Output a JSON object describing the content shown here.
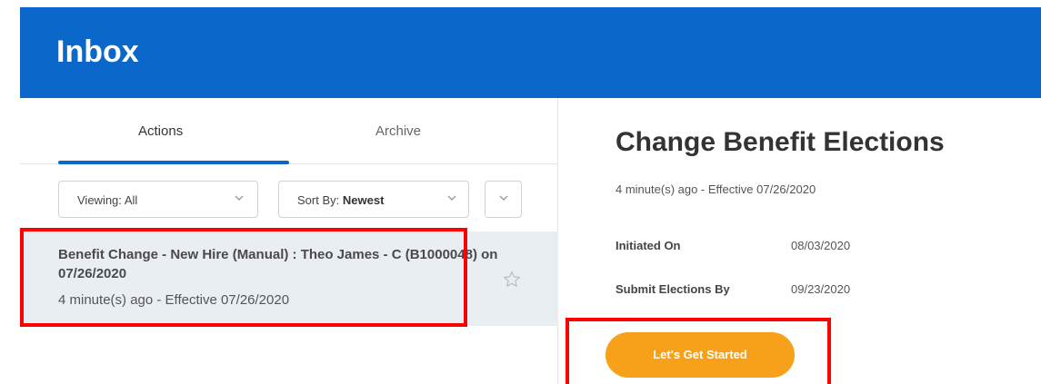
{
  "header": {
    "title": "Inbox"
  },
  "tabs": [
    {
      "label": "Actions",
      "active": true
    },
    {
      "label": "Archive",
      "active": false
    }
  ],
  "filters": {
    "viewing": {
      "label": "Viewing:",
      "value": "All"
    },
    "sort": {
      "label": "Sort By:",
      "value": "Newest"
    }
  },
  "inbox_items": [
    {
      "title": "Benefit Change - New Hire (Manual) : Theo James - C (B1000048) on 07/26/2020",
      "subtitle": "4 minute(s) ago - Effective 07/26/2020",
      "icon": "star-outline-icon"
    }
  ],
  "detail": {
    "title": "Change Benefit Elections",
    "subtitle": "4 minute(s) ago -  Effective 07/26/2020",
    "fields": [
      {
        "label": "Initiated On",
        "value": "08/03/2020"
      },
      {
        "label": "Submit Elections By",
        "value": "09/23/2020"
      }
    ],
    "cta_label": "Let's Get Started"
  },
  "colors": {
    "header_bg": "#0b67c9",
    "accent": "#0b67c9",
    "cta_bg": "#f7a11a",
    "highlight": "#ff0000",
    "selected_row_bg": "#e9eef3"
  }
}
